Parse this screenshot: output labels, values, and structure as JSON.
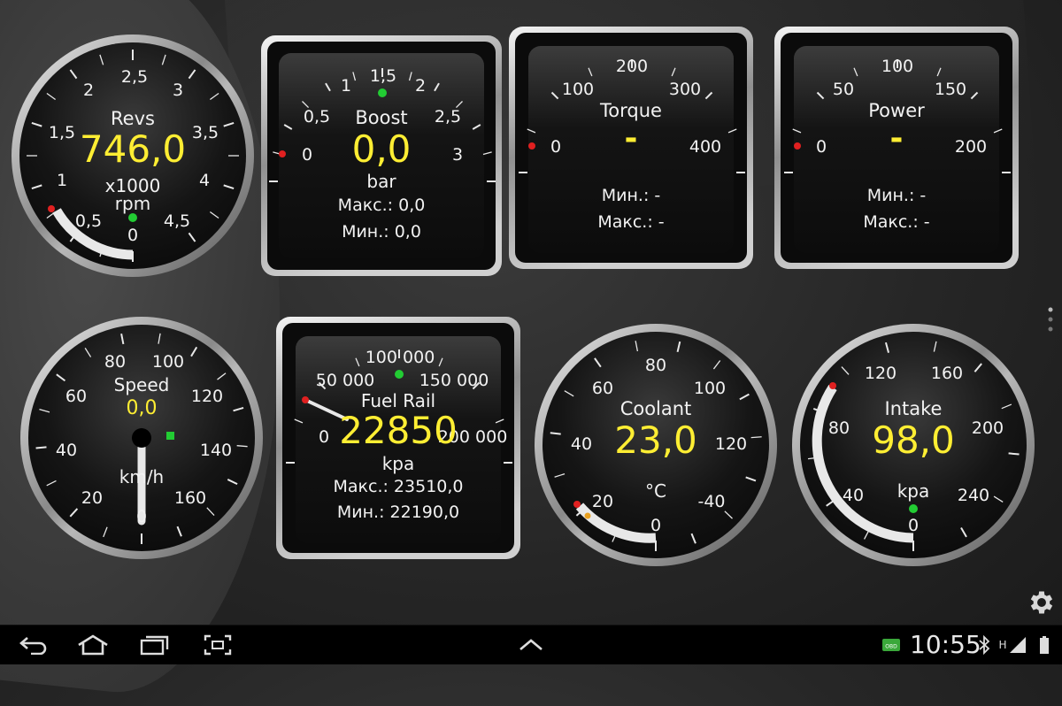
{
  "gauges": {
    "revs": {
      "title": "Revs",
      "value": "746,0",
      "unit1": "x1000",
      "unit2": "rpm",
      "ticks": [
        "0",
        "0,5",
        "1",
        "1,5",
        "2",
        "2,5",
        "3",
        "3,5",
        "4",
        "4,5"
      ]
    },
    "boost": {
      "title": "Boost",
      "value": "0,0",
      "unit": "bar",
      "max_label": "Макс.: 0,0",
      "min_label": "Мин.: 0,0",
      "ticks": [
        "0",
        "0,5",
        "1",
        "1,5",
        "2",
        "2,5",
        "3"
      ]
    },
    "torque": {
      "title": "Torque",
      "value": "-",
      "min_label": "Мин.: -",
      "max_label": "Макс.: -",
      "ticks": [
        "0",
        "100",
        "200",
        "300",
        "400"
      ]
    },
    "power": {
      "title": "Power",
      "value": "-",
      "min_label": "Мин.: -",
      "max_label": "Макс.: -",
      "ticks": [
        "0",
        "50",
        "100",
        "150",
        "200"
      ]
    },
    "speed": {
      "title": "Speed",
      "value": "0,0",
      "unit": "km/h",
      "ticks": [
        "0",
        "20",
        "40",
        "60",
        "80",
        "100",
        "120",
        "140",
        "160"
      ]
    },
    "fuel_rail": {
      "title": "Fuel Rail",
      "value": "22850",
      "unit": "kpa",
      "max_label": "Макс.: 23510,0",
      "min_label": "Мин.: 22190,0",
      "ticks": [
        "0",
        "50 000",
        "100 000",
        "150 000",
        "200 000"
      ]
    },
    "coolant": {
      "title": "Coolant",
      "value": "23,0",
      "unit": "°C",
      "ticks": [
        "0",
        "-40",
        "20",
        "40",
        "60",
        "80",
        "100",
        "120"
      ]
    },
    "intake": {
      "title": "Intake",
      "value": "98,0",
      "unit": "kpa",
      "ticks": [
        "0",
        "40",
        "80",
        "120",
        "160",
        "200",
        "240"
      ]
    }
  },
  "taskbar": {
    "clock": "10:55",
    "obd_badge": "OBD",
    "network_label": "H"
  },
  "colors": {
    "accent": "#ffee33",
    "needle_red": "#e02020",
    "indicator_green": "#22cc33",
    "arc_white": "#e8e8e8"
  },
  "icons": [
    "back-icon",
    "home-icon",
    "recent-apps-icon",
    "screenshot-icon",
    "chevron-up-icon",
    "obd-icon",
    "bluetooth-icon",
    "signal-icon",
    "gear-icon"
  ]
}
